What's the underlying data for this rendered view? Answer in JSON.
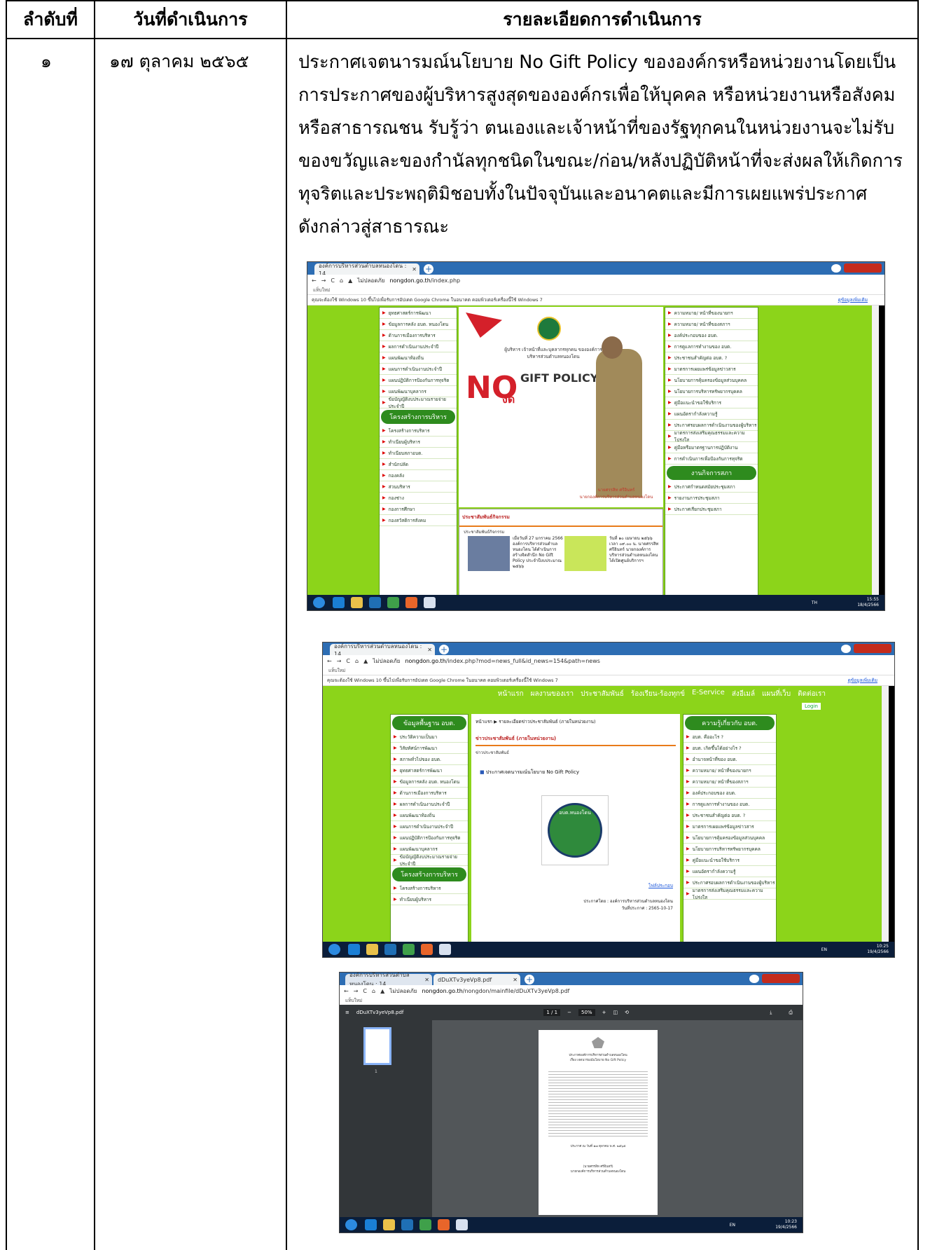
{
  "table": {
    "headers": [
      "ลำดับที่",
      "วันที่ดำเนินการ",
      "รายละเอียดการดำเนินการ"
    ],
    "row": {
      "index": "๑",
      "date": "๑๗  ตุลาคม ๒๕๖๕",
      "detail_lines": [
        "ประกาศเจตนารมณ์นโยบาย No Gift Policy ขององค์กรหรือหน่วยงานโดยเป็น",
        "การประกาศของผู้บริหารสูงสุดขององค์กรเพื่อให้บุคคล หรือหน่วยงานหรือสังคม",
        "หรือสาธารณชน รับรู้ว่า ตนเองและเจ้าหน้าที่ของรัฐทุกคนในหน่วยงานจะไม่รับ",
        "ของขวัญและของกำนัลทุกชนิดในขณะ/ก่อน/หลังปฏิบัติหน้าที่จะส่งผลให้เกิดการ",
        "ทุจริตและประพฤติมิชอบทั้งในปัจจุบันและอนาคตและมีการเผยแพร่ประกาศ",
        "ดังกล่าวสู่สาธารณะ"
      ]
    }
  },
  "screenshots": {
    "shot1": {
      "tab_title": "องค์การบริหารส่วนตำบลหนองโดน : 14",
      "url_warning": "ไม่ปลอดภัย",
      "url_host": "nongdon.go.th",
      "url_path": "/index.php",
      "bookmark": "แท็บใหม่",
      "infobar": "คุณจะต้องใช้ Windows 10 ขึ้นไปเพื่อรับการอัปเดต Google Chrome ในอนาคต คอมพิวเตอร์เครื่องนี้ใช้ Windows 7",
      "infobar_link": "ดูข้อมูลเพิ่มเติม",
      "left_nav": [
        "ยุทธศาสตร์การพัฒนา",
        "ข้อมูลการคลัง อบต. หนองโดน",
        "ด้านการเมืองการบริหาร",
        "ผลการดำเนินงานประจำปี",
        "แผนพัฒนาท้องถิ่น",
        "แผนการดำเนินงานประจำปี",
        "แผนปฏิบัติการป้องกันการทุจริต",
        "แผนพัฒนาบุคลากร",
        "ข้อบัญญัติงบประมาณรายจ่ายประจำปี"
      ],
      "left_nav_head": "โครงสร้างการบริหาร",
      "left_nav2": [
        "โครงสร้างการบริหาร",
        "ทำเนียบผู้บริหาร",
        "ทำเนียบสภาอบต.",
        "สำนักปลัด",
        "กองคลัง",
        "ส่วนบริหาร",
        "กองช่าง",
        "กองการศึกษา",
        "กองสวัสดิการสังคม"
      ],
      "right_nav": [
        "ความหมาย/ หน้าที่ของนายกฯ",
        "ความหมาย/ หน้าที่ของสภาฯ",
        "องค์ประกอบของ อบต.",
        "การดูแลการทำงานของ อบต.",
        "ประชาชนสำคัญต่อ อบต. ?",
        "มาตรการเผยแพร่ข้อมูลข่าวสาร",
        "นโยบายการคุ้มครองข้อมูลส่วนบุคคล",
        "นโยบายการบริหารทรัพยากรบุคคล",
        "คู่มือแนะนำขอใช้บริการ",
        "แผนอัตรากำลังความรู้",
        "ประกาศรอบผลการดำเนินงานของผู้บริหาร",
        "มาตรการส่งเสริมคุณธรรมและความโปร่งใส",
        "คู่มือหรือมาตรฐานการปฏิบัติงาน",
        "การดำเนินการเพื่อป้องกันการทุจริต"
      ],
      "right_nav_head": "งานกิจการสภา",
      "right_nav2": [
        "ประกาศกำหนดสมัยประชุมสภา",
        "รายงานการประชุมสภา",
        "ประกาศเรียกประชุมสภา"
      ],
      "banner_gift": "GIFT POLICY",
      "banner_no": "NO",
      "banner_text": "ผู้บริหาร เจ้าหน้าที่และบุคลากรทุกคน ขององค์การบริหารส่วนตำบลหนองโดน",
      "banner_jod": "งด",
      "banner_name": "นายศรรสิท ศรีอินทร์",
      "banner_title": "นายกองค์การบริหารส่วนตำบลหนองโดน",
      "news_head": "ประชาสัมพันธ์กิจกรรม",
      "news_sub": "ประชาสัมพันธ์กิจกรรม",
      "news1": "เมื่อวันที่ 27 มกราคม 2566 องค์การบริหารส่วนตำบลหนองโดน ได้ดำเนินการสร้างจิตสำนึก No Gift Policy ประจำปีงบประมาณ ๒๕๖๖",
      "news2": "วันที่ ๑๐ เมษายน ๒๕๖๖ เวลา ๐๙.๐๐ น. นายศรรสิท ศรีอินทร์ นายกองค์การบริหารส่วนตำบลหนองโดน ได้เปิดศูนย์บริการฯ",
      "clock_time": "15:55",
      "clock_date": "18/4/2566",
      "lang": "TH"
    },
    "shot2": {
      "tab_title": "องค์การบริหารส่วนตำบลหนองโดน : 14",
      "url_warning": "ไม่ปลอดภัย",
      "url_host": "nongdon.go.th",
      "url_path": "/index.php?mod=news_full&id_news=154&path=news",
      "bookmark": "แท็บใหม่",
      "infobar": "คุณจะต้องใช้ Windows 10 ขึ้นไปเพื่อรับการอัปเดต Google Chrome ในอนาคต คอมพิวเตอร์เครื่องนี้ใช้ Windows 7",
      "infobar_link": "ดูข้อมูลเพิ่มเติม",
      "menu": [
        "หน้าแรก",
        "ผลงานของเรา",
        "ประชาสัมพันธ์",
        "ร้องเรียน-ร้องทุกข์",
        "E-Service",
        "ส่งอีเมล์",
        "แผนที่เว็บ",
        "ติดต่อเรา"
      ],
      "login": "Login",
      "left_head": "ข้อมูลพื้นฐาน อบต.",
      "left_nav": [
        "ประวัติความเป็นมา",
        "วิสัยทัศน์การพัฒนา",
        "สภาพทั่วไปของ อบต.",
        "ยุทธศาสตร์การพัฒนา",
        "ข้อมูลการคลัง อบต. หนองโดน",
        "ด้านการเมืองการบริหาร",
        "ผลการดำเนินงานประจำปี",
        "แผนพัฒนาท้องถิ่น",
        "แผนการดำเนินงานประจำปี",
        "แผนปฏิบัติการป้องกันการทุจริต",
        "แผนพัฒนาบุคลากร",
        "ข้อบัญญัติงบประมาณรายจ่ายประจำปี"
      ],
      "left_head2": "โครงสร้างการบริหาร",
      "left_nav2": [
        "โครงสร้างการบริหาร",
        "ทำเนียบผู้บริหาร"
      ],
      "right_head": "ความรู้เกี่ยวกับ อบต.",
      "right_nav": [
        "อบต. คืออะไร ?",
        "อบต. เกิดขึ้นได้อย่างไร ?",
        "อำนาจหน้าที่ของ อบต.",
        "ความหมาย/ หน้าที่ของนายกฯ",
        "ความหมาย/ หน้าที่ของสภาฯ",
        "องค์ประกอบของ อบต.",
        "การดูแลการทำงานของ อบต.",
        "ประชาชนสำคัญต่อ อบต. ?",
        "มาตรการเผยแพร่ข้อมูลข่าวสาร",
        "นโยบายการคุ้มครองข้อมูลส่วนบุคคล",
        "นโยบายการบริหารทรัพยากรบุคคล",
        "คู่มือแนะนำขอใช้บริการ",
        "แผนอัตรากำลังความรู้",
        "ประกาศรอบผลการดำเนินงานของผู้บริหาร",
        "มาตรการส่งเสริมคุณธรรมและความโปร่งใส"
      ],
      "breadcrumb_home": "หน้าแรก",
      "breadcrumb_page": "รายละเอียดข่าวประชาสัมพันธ์ (ภายในหน่วยงาน)",
      "news_head": "ข่าวประชาสัมพันธ์ (ภายในหน่วยงาน)",
      "news_sub": "ข่าวประชาสัมพันธ์",
      "news_title": "ประกาศเจตนารมณ์นโยบาย No Gift Policy",
      "logo_text": "อบต.หนองโดน",
      "attachment": "ไฟล์ประกอบ",
      "posted_by": "ประกาศโดย : องค์การบริหารส่วนตำบลหนองโดน",
      "posted_date": "วันที่ประกาศ : 2565-10-17",
      "clock_time": "10:25",
      "clock_date": "19/4/2566",
      "lang": "EN"
    },
    "shot3": {
      "tab_title": "องค์การบริหารส่วนตำบลหนองโดน : 14",
      "tab2_title": "dDuXTv3yeVp8.pdf",
      "url_warning": "ไม่ปลอดภัย",
      "url_host": "nongdon.go.th",
      "url_path": "/nongdon/mainfile/dDuXTv3yeVp8.pdf",
      "bookmark": "แท็บใหม่",
      "pdf_name": "dDuXTv3yeVp8.pdf",
      "page_info": "1 / 1",
      "zoom": "50%",
      "thumb_label": "1",
      "doc_title1": "ประกาศองค์การบริหารส่วนตำบลหนองโดน",
      "doc_title2": "เรื่อง เจตนารมณ์นโยบาย No Gift Policy",
      "doc_date": "ประกาศ ณ วันที่  ๑๗  ตุลาคม พ.ศ. ๒๕๖๕",
      "doc_signer": "(นายศรรสิท  ศรีอินทร์)",
      "doc_signer_title": "นายกองค์การบริหารส่วนตำบลหนองโดน",
      "clock_time": "10:23",
      "clock_date": "19/4/2566",
      "lang": "EN"
    }
  },
  "colors": {
    "green": "#8cd41a",
    "nav_green": "#2e8b1e",
    "taskbar": "#0b1e3a",
    "chrome_blue": "#2d6db3"
  }
}
